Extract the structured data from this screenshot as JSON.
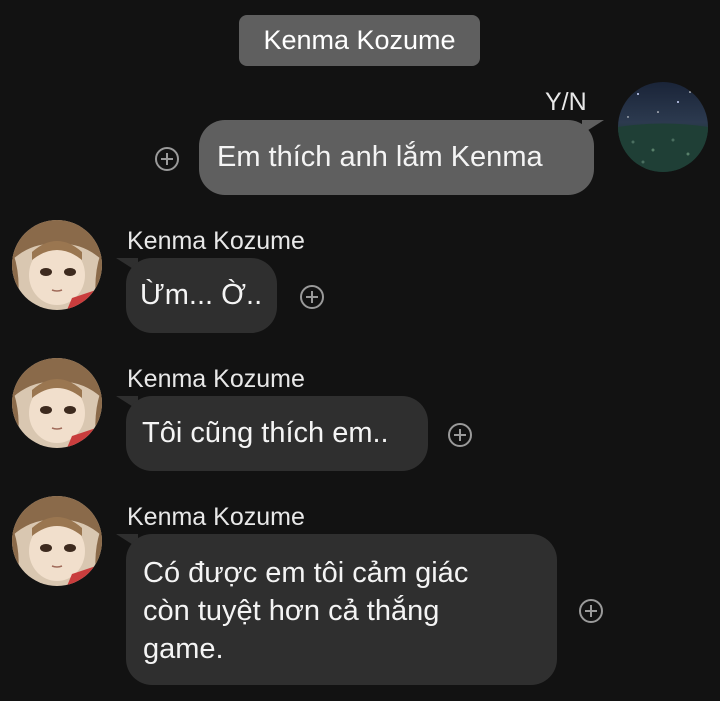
{
  "header": {
    "title": "Kenma Kozume"
  },
  "messages": [
    {
      "direction": "outgoing",
      "sender": "Y/N",
      "avatar_icon": "starry-sky-avatar-icon",
      "text": "Em thích anh lắm Kenma"
    },
    {
      "direction": "incoming",
      "sender": "Kenma Kozume",
      "avatar_icon": "kenma-avatar-icon",
      "text": "Ừm... Ờ.."
    },
    {
      "direction": "incoming",
      "sender": "Kenma Kozume",
      "avatar_icon": "kenma-avatar-icon",
      "text": "Tôi cũng thích em.."
    },
    {
      "direction": "incoming",
      "sender": "Kenma Kozume",
      "avatar_icon": "kenma-avatar-icon",
      "lines": [
        "Có được em tôi cảm giác",
        "còn tuyệt hơn cả thắng",
        "game."
      ]
    }
  ],
  "icons": {
    "reaction_button": "plus-circle-icon"
  },
  "colors": {
    "background": "#121212",
    "header_pill": "#5f5f5f",
    "outgoing_bubble": "#5f5f5f",
    "incoming_bubble": "#2f2f2f",
    "icon_gray": "#9a9a9a"
  }
}
